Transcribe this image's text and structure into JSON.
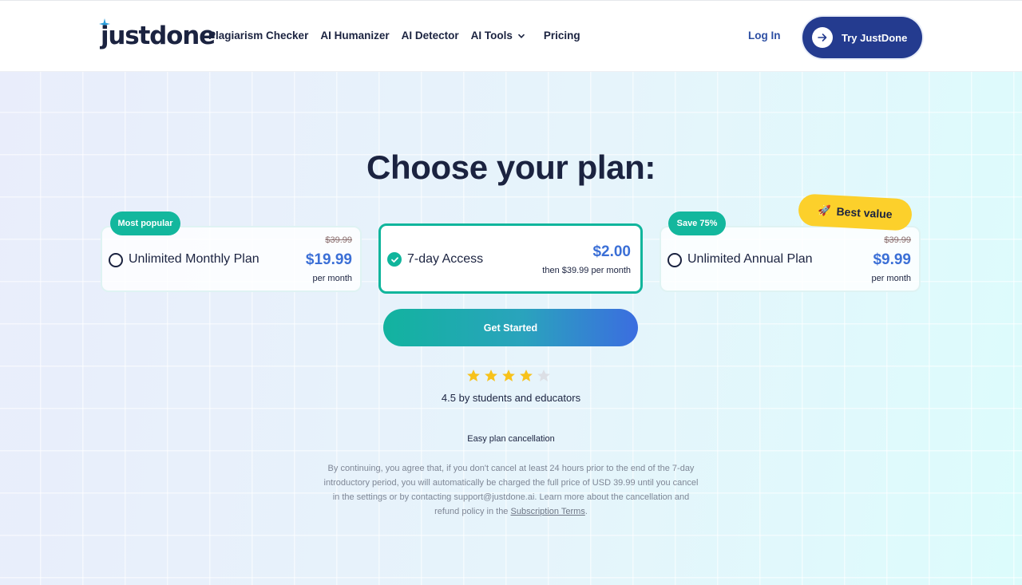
{
  "header": {
    "logo": "justdone",
    "nav": [
      "Plagiarism Checker",
      "AI Humanizer",
      "AI Detector",
      "AI Tools",
      "Pricing"
    ],
    "login": "Log In",
    "cta": "Try JustDone"
  },
  "main": {
    "title": "Choose your plan:",
    "plans": [
      {
        "badge": "Most popular",
        "name": "Unlimited Monthly Plan",
        "old_price": "$39.99",
        "price": "$19.99",
        "period": "per month",
        "selected": false
      },
      {
        "name": "7-day Access",
        "price": "$2.00",
        "period": "then $39.99 per month",
        "selected": true
      },
      {
        "badge": "Save 75%",
        "name": "Unlimited Annual Plan",
        "old_price": "$39.99",
        "price": "$9.99",
        "period": "per month",
        "selected": false
      }
    ],
    "best_value": "Best value",
    "get_started": "Get Started",
    "rating": {
      "stars": 4,
      "max": 5,
      "text": "4.5 by students and educators"
    },
    "easy_cancel": "Easy plan cancellation",
    "disclaimer": "By continuing, you agree that, if you don't cancel at least 24 hours prior to the end of the 7-day introductory period, you will automatically be charged the full price of USD 39.99 until you cancel in the settings or by contacting support@justdone.ai. Learn more about the cancellation and refund policy in the",
    "disclaimer_link": "Subscription Terms",
    "disclaimer_end": "."
  },
  "colors": {
    "brand_navy": "#243b8f",
    "teal": "#13b79d",
    "price_blue": "#3b6fd6",
    "yellow": "#fcd02b"
  }
}
